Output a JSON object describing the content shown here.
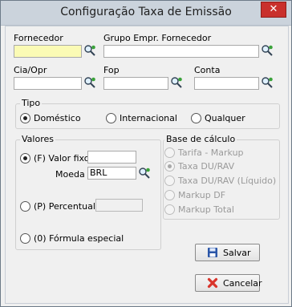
{
  "window": {
    "title": "Configuração Taxa de Emissão",
    "close_glyph": "✕"
  },
  "fields": {
    "fornecedor": {
      "label": "Fornecedor",
      "value": ""
    },
    "grupo": {
      "label": "Grupo Empr. Fornecedor",
      "value": ""
    },
    "cia": {
      "label": "Cia/Opr",
      "value": ""
    },
    "fop": {
      "label": "Fop",
      "value": ""
    },
    "conta": {
      "label": "Conta",
      "value": ""
    }
  },
  "tipo": {
    "title": "Tipo",
    "options": [
      "Doméstico",
      "Internacional",
      "Qualquer"
    ],
    "selected": "Doméstico"
  },
  "valores": {
    "title": "Valores",
    "valor_fixo": {
      "label": "(F) Valor fixo",
      "value": ""
    },
    "moeda": {
      "label": "Moeda",
      "value": "BRL"
    },
    "percentual": {
      "label": "(P) Percentual",
      "value": ""
    },
    "formula": {
      "label": "(0) Fórmula especial"
    },
    "selected": "(F) Valor fixo"
  },
  "base": {
    "title": "Base de cálculo",
    "options": [
      "Tarifa - Markup",
      "Taxa DU/RAV",
      "Taxa DU/RAV (Líquido)",
      "Markup DF",
      "Markup Total"
    ],
    "selected": "Taxa DU/RAV"
  },
  "buttons": {
    "save": "Salvar",
    "cancel": "Cancelar"
  },
  "colors": {
    "required_field": "#fbfbb5",
    "cancel_icon": "#d9342b",
    "save_icon": "#2b56a8"
  }
}
